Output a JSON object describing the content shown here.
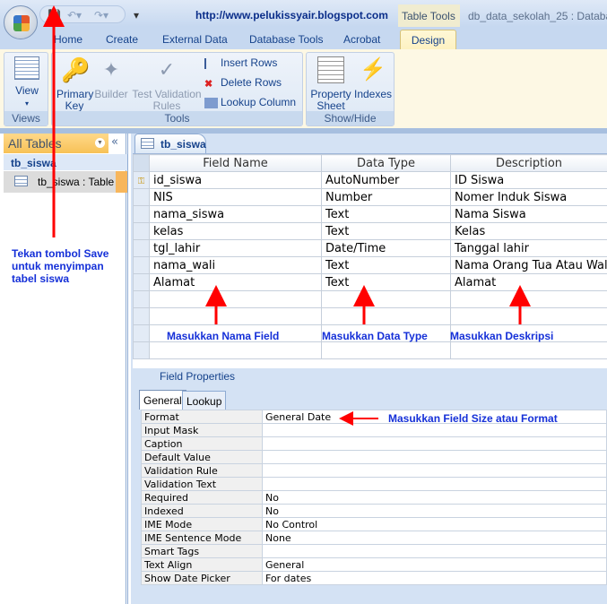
{
  "title_bar": {
    "url": "http://www.pelukissyair.blogspot.com",
    "context_tab": "Table Tools",
    "window_title": "db_data_sekolah_25 : Databas"
  },
  "tabs": [
    "Home",
    "Create",
    "External Data",
    "Database Tools",
    "Acrobat",
    "Design"
  ],
  "ribbon": {
    "views": {
      "view": "View",
      "label": "Views"
    },
    "tools": {
      "primary_key": "Primary Key",
      "builder": "Builder",
      "test_validation": "Test Validation Rules",
      "insert_rows": "Insert Rows",
      "delete_rows": "Delete Rows",
      "lookup_column": "Lookup Column",
      "label": "Tools"
    },
    "show_hide": {
      "property_sheet": "Property Sheet",
      "indexes": "Indexes",
      "label": "Show/Hide"
    }
  },
  "nav": {
    "header": "All Tables",
    "group": "tb_siswa",
    "item": "tb_siswa : Table"
  },
  "document_tab": "tb_siswa",
  "grid": {
    "headers": [
      "Field Name",
      "Data Type",
      "Description"
    ],
    "rows": [
      [
        "id_siswa",
        "AutoNumber",
        "ID Siswa"
      ],
      [
        "NIS",
        "Number",
        "Nomer Induk Siswa"
      ],
      [
        "nama_siswa",
        "Text",
        "Nama Siswa"
      ],
      [
        "kelas",
        "Text",
        "Kelas"
      ],
      [
        "tgl_lahir",
        "Date/Time",
        "Tanggal lahir"
      ],
      [
        "nama_wali",
        "Text",
        "Nama Orang Tua Atau Wali"
      ],
      [
        "Alamat",
        "Text",
        "Alamat"
      ]
    ]
  },
  "field_properties": {
    "label": "Field Properties",
    "tabs": [
      "General",
      "Lookup"
    ],
    "rows": [
      [
        "Format",
        "General Date"
      ],
      [
        "Input Mask",
        ""
      ],
      [
        "Caption",
        ""
      ],
      [
        "Default Value",
        ""
      ],
      [
        "Validation Rule",
        ""
      ],
      [
        "Validation Text",
        ""
      ],
      [
        "Required",
        "No"
      ],
      [
        "Indexed",
        "No"
      ],
      [
        "IME Mode",
        "No Control"
      ],
      [
        "IME Sentence Mode",
        "None"
      ],
      [
        "Smart Tags",
        ""
      ],
      [
        "Text Align",
        "General"
      ],
      [
        "Show Date Picker",
        "For dates"
      ]
    ]
  },
  "annotations": {
    "save": "Tekan tombol Save untuk menyimpan tabel siswa",
    "field_name": "Masukkan Nama Field",
    "data_type": "Masukkan Data Type",
    "description": "Masukkan Deskripsi",
    "field_size": "Masukkan Field Size atau Format"
  }
}
